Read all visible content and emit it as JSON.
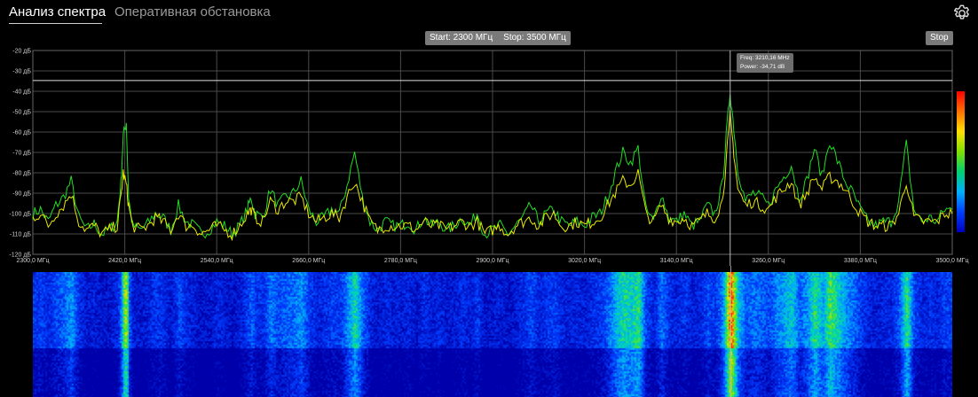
{
  "tabs": [
    "Анализ спектра",
    "Оперативная обстановка"
  ],
  "controls": {
    "start_label": "Start: 2300 МГц",
    "stop_label": "Stop: 3500 МГц",
    "stop_button": "Stop"
  },
  "tooltip": {
    "freq": "Freq: 3210,16 MHz",
    "power": "Power: -34,71 dB"
  },
  "colors": {
    "background": "#000000",
    "grid": "#555555",
    "trace_green": "#22dd22",
    "trace_yellow": "#e8e800",
    "button": "#7a7a7a"
  },
  "icons": {
    "settings": "gear-icon"
  },
  "chart_data": {
    "type": "line",
    "title": "",
    "xlim": [
      2300,
      3500
    ],
    "ylim": [
      -120,
      -20
    ],
    "x_ticks": [
      "2300,0 МГц",
      "2420,0 МГц",
      "2540,0 МГц",
      "2660,0 МГц",
      "2780,0 МГц",
      "2900,0 МГц",
      "3020,0 МГц",
      "3140,0 МГц",
      "3260,0 МГц",
      "3380,0 МГц",
      "3500,0 МГц"
    ],
    "y_ticks": [
      "-20 дБ",
      "-30 дБ",
      "-40 дБ",
      "-50 дБ",
      "-60 дБ",
      "-70 дБ",
      "-80 дБ",
      "-90 дБ",
      "-100 дБ",
      "-110 дБ",
      "-120 дБ"
    ],
    "threshold": -34.71,
    "marker_freq": 3210.16,
    "series": [
      {
        "color": "#22dd22",
        "x": [
          2300,
          2310,
          2320,
          2330,
          2340,
          2350,
          2360,
          2370,
          2380,
          2390,
          2400,
          2410,
          2415,
          2418,
          2422,
          2425,
          2430,
          2440,
          2450,
          2460,
          2470,
          2480,
          2490,
          2500,
          2510,
          2520,
          2530,
          2540,
          2550,
          2560,
          2570,
          2580,
          2585,
          2590,
          2600,
          2610,
          2620,
          2630,
          2640,
          2650,
          2660,
          2670,
          2680,
          2690,
          2700,
          2710,
          2720,
          2730,
          2740,
          2750,
          2760,
          2770,
          2780,
          2790,
          2800,
          2810,
          2820,
          2830,
          2840,
          2850,
          2860,
          2870,
          2880,
          2890,
          2900,
          2910,
          2920,
          2930,
          2940,
          2950,
          2960,
          2970,
          2980,
          2990,
          3000,
          3010,
          3020,
          3030,
          3040,
          3050,
          3060,
          3070,
          3080,
          3090,
          3100,
          3110,
          3120,
          3130,
          3140,
          3150,
          3160,
          3170,
          3180,
          3190,
          3200,
          3205,
          3210,
          3215,
          3220,
          3230,
          3240,
          3250,
          3260,
          3270,
          3280,
          3290,
          3300,
          3310,
          3320,
          3330,
          3340,
          3350,
          3360,
          3370,
          3380,
          3390,
          3400,
          3410,
          3420,
          3430,
          3440,
          3450,
          3460,
          3470,
          3480,
          3490,
          3500
        ],
        "y": [
          -100,
          -98,
          -104,
          -96,
          -92,
          -84,
          -102,
          -108,
          -105,
          -110,
          -108,
          -104,
          -85,
          -62,
          -55,
          -92,
          -106,
          -108,
          -105,
          -100,
          -102,
          -108,
          -96,
          -104,
          -106,
          -110,
          -108,
          -104,
          -106,
          -110,
          -106,
          -98,
          -92,
          -100,
          -102,
          -88,
          -96,
          -92,
          -90,
          -84,
          -98,
          -104,
          -102,
          -98,
          -100,
          -86,
          -70,
          -92,
          -104,
          -108,
          -104,
          -106,
          -106,
          -104,
          -108,
          -102,
          -106,
          -104,
          -108,
          -106,
          -102,
          -106,
          -100,
          -110,
          -108,
          -106,
          -110,
          -106,
          -102,
          -96,
          -104,
          -100,
          -98,
          -104,
          -106,
          -104,
          -106,
          -102,
          -100,
          -92,
          -80,
          -70,
          -75,
          -68,
          -98,
          -104,
          -90,
          -102,
          -104,
          -100,
          -106,
          -104,
          -96,
          -100,
          -86,
          -62,
          -40,
          -58,
          -78,
          -94,
          -90,
          -92,
          -96,
          -88,
          -82,
          -76,
          -92,
          -84,
          -68,
          -82,
          -64,
          -74,
          -84,
          -90,
          -98,
          -104,
          -106,
          -104,
          -104,
          -94,
          -66,
          -98,
          -104,
          -102,
          -104,
          -98,
          -98
        ]
      },
      {
        "color": "#e8e800",
        "x": [
          2300,
          2310,
          2320,
          2330,
          2340,
          2350,
          2360,
          2370,
          2380,
          2390,
          2400,
          2410,
          2415,
          2418,
          2422,
          2425,
          2430,
          2440,
          2450,
          2460,
          2470,
          2480,
          2490,
          2500,
          2510,
          2520,
          2530,
          2540,
          2550,
          2560,
          2570,
          2580,
          2585,
          2590,
          2600,
          2610,
          2620,
          2630,
          2640,
          2650,
          2660,
          2670,
          2680,
          2690,
          2700,
          2710,
          2720,
          2730,
          2740,
          2750,
          2760,
          2770,
          2780,
          2790,
          2800,
          2810,
          2820,
          2830,
          2840,
          2850,
          2860,
          2870,
          2880,
          2890,
          2900,
          2910,
          2920,
          2930,
          2940,
          2950,
          2960,
          2970,
          2980,
          2990,
          3000,
          3010,
          3020,
          3030,
          3040,
          3050,
          3060,
          3070,
          3080,
          3090,
          3100,
          3110,
          3120,
          3130,
          3140,
          3150,
          3160,
          3170,
          3180,
          3190,
          3200,
          3205,
          3210,
          3215,
          3220,
          3230,
          3240,
          3250,
          3260,
          3270,
          3280,
          3290,
          3300,
          3310,
          3320,
          3330,
          3340,
          3350,
          3360,
          3370,
          3380,
          3390,
          3400,
          3410,
          3420,
          3430,
          3440,
          3450,
          3460,
          3470,
          3480,
          3490,
          3500
        ],
        "y": [
          -102,
          -100,
          -106,
          -100,
          -96,
          -90,
          -104,
          -108,
          -106,
          -110,
          -108,
          -106,
          -92,
          -80,
          -86,
          -96,
          -106,
          -108,
          -106,
          -102,
          -104,
          -108,
          -100,
          -106,
          -106,
          -110,
          -108,
          -106,
          -108,
          -110,
          -106,
          -100,
          -98,
          -102,
          -104,
          -94,
          -98,
          -94,
          -94,
          -92,
          -100,
          -104,
          -102,
          -100,
          -102,
          -92,
          -84,
          -94,
          -104,
          -108,
          -106,
          -106,
          -106,
          -106,
          -108,
          -104,
          -106,
          -106,
          -108,
          -106,
          -104,
          -106,
          -104,
          -110,
          -108,
          -106,
          -110,
          -106,
          -104,
          -102,
          -106,
          -102,
          -100,
          -106,
          -106,
          -104,
          -106,
          -104,
          -102,
          -96,
          -90,
          -84,
          -86,
          -80,
          -100,
          -104,
          -96,
          -102,
          -104,
          -102,
          -106,
          -104,
          -100,
          -102,
          -94,
          -74,
          -52,
          -70,
          -88,
          -96,
          -94,
          -96,
          -98,
          -92,
          -88,
          -84,
          -96,
          -90,
          -82,
          -88,
          -82,
          -84,
          -88,
          -94,
          -100,
          -104,
          -106,
          -106,
          -106,
          -100,
          -84,
          -102,
          -104,
          -104,
          -104,
          -100,
          -100
        ]
      }
    ]
  }
}
